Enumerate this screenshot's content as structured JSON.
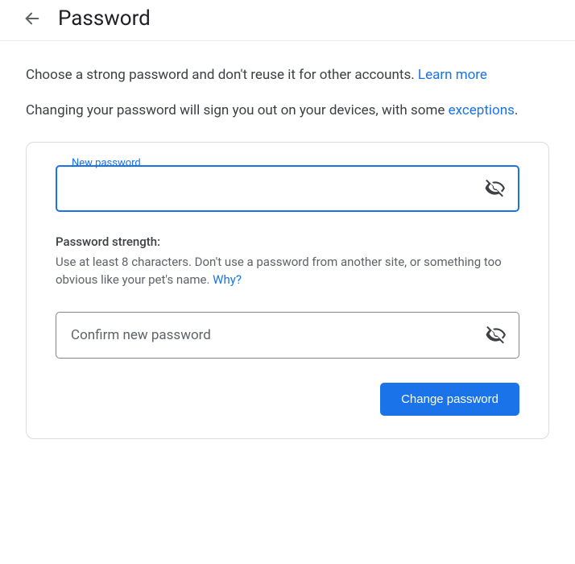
{
  "header": {
    "title": "Password"
  },
  "intro": {
    "line1_prefix": "Choose a strong password and don't reuse it for other accounts. ",
    "learn_more": "Learn more",
    "line2_prefix": "Changing your password will sign you out on your devices, with some ",
    "exceptions": "excep­tions",
    "line2_suffix": "."
  },
  "form": {
    "new_password_label": "New password",
    "confirm_label": "Confirm new password",
    "strength_title": "Password strength:",
    "strength_help_prefix": "Use at least 8 characters. Don't use a password from another site, or something too obvious like your pet's name. ",
    "why_link": "Why?",
    "submit_label": "Change password"
  },
  "colors": {
    "accent": "#1a73e8",
    "border": "#dadce0",
    "text_secondary": "#5f6368"
  }
}
